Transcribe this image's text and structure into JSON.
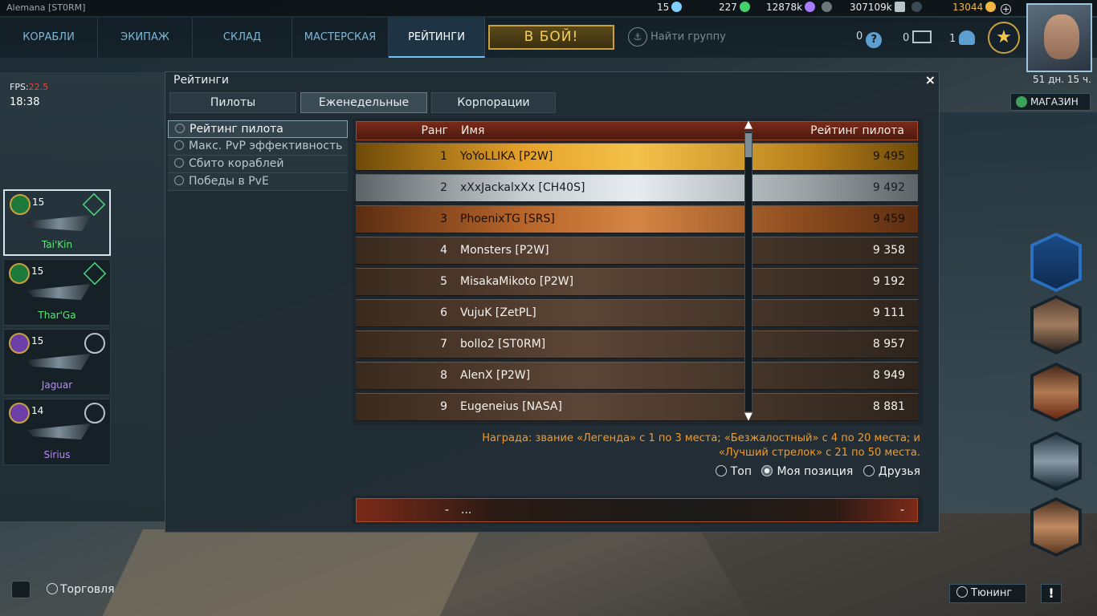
{
  "topbar": {
    "player": "Alemana [ST0RM]",
    "resources": [
      {
        "value": "15",
        "icon": "crystal-icon",
        "color": "#7fd0ff"
      },
      {
        "value": "227",
        "icon": "leaf-icon",
        "color": "#44d06a"
      },
      {
        "value": "12878k",
        "icon": "monocrystal-icon",
        "color": "#a77cff"
      },
      {
        "value": "307109k",
        "icon": "credits-icon",
        "color": "#b8c4ca"
      },
      {
        "value": "13044",
        "icon": "gold-icon",
        "color": "#f2b640"
      }
    ]
  },
  "nav": {
    "tabs": [
      "КОРАБЛИ",
      "ЭКИПАЖ",
      "СКЛАД",
      "МАСТЕРСКАЯ",
      "РЕЙТИНГИ"
    ],
    "active_tab": "РЕЙТИНГИ",
    "fight_button": "В БОЙ!",
    "find_group": "Найти группу",
    "help_count": "0",
    "mail_count": "0",
    "friends_count": "1",
    "timer": "51 дн. 15 ч.",
    "shop": "МАГАЗИН"
  },
  "hud": {
    "fps_label": "FPS:",
    "fps_value": "22.5",
    "clock": "18:38"
  },
  "ships": [
    {
      "level": "15",
      "name": "Tai'Kin",
      "selected": true,
      "tier": "green"
    },
    {
      "level": "15",
      "name": "Thar'Ga",
      "selected": false,
      "tier": "green"
    },
    {
      "level": "15",
      "name": "Jaguar",
      "selected": false,
      "tier": "purple"
    },
    {
      "level": "14",
      "name": "Sirius",
      "selected": false,
      "tier": "purple"
    }
  ],
  "window": {
    "title": "Рейтинги",
    "close": "×",
    "subtabs": [
      "Пилоты",
      "Еженедельные",
      "Корпорации"
    ],
    "active_subtab": "Еженедельные",
    "categories": [
      "Рейтинг пилота",
      "Макс. PvP эффективность",
      "Сбито кораблей",
      "Победы в PvE"
    ],
    "active_category": "Рейтинг пилота",
    "columns": {
      "rank": "Ранг",
      "name": "Имя",
      "score": "Рейтинг пилота"
    },
    "rows": [
      {
        "rank": "1",
        "name": "YoYoLLIKA [P2W]",
        "score": "9 495"
      },
      {
        "rank": "2",
        "name": "xXxJackalxXx [CH40S]",
        "score": "9 492"
      },
      {
        "rank": "3",
        "name": "PhoenixTG [SRS]",
        "score": "9 459"
      },
      {
        "rank": "4",
        "name": "Monsters [P2W]",
        "score": "9 358"
      },
      {
        "rank": "5",
        "name": "MisakaMikoto [P2W]",
        "score": "9 192"
      },
      {
        "rank": "6",
        "name": "VujuK [ZetPL]",
        "score": "9 111"
      },
      {
        "rank": "7",
        "name": "bollo2 [ST0RM]",
        "score": "8 957"
      },
      {
        "rank": "8",
        "name": "AlenX [P2W]",
        "score": "8 949"
      },
      {
        "rank": "9",
        "name": "Eugeneius [NASA]",
        "score": "8 881"
      }
    ],
    "reward_line1": "Награда: звание «Легенда» с 1 по 3 места; «Безжалостный» с 4 по 20 места; и",
    "reward_line2": "«Лучший стрелок» с 21 по 50 места.",
    "filters": [
      "Топ",
      "Моя позиция",
      "Друзья"
    ],
    "active_filter": "Моя позиция",
    "my_row": {
      "rank": "-",
      "name": "...",
      "score": "-"
    }
  },
  "bottom": {
    "trade": "Торговля",
    "tuning": "Тюнинг",
    "alert": "!"
  }
}
